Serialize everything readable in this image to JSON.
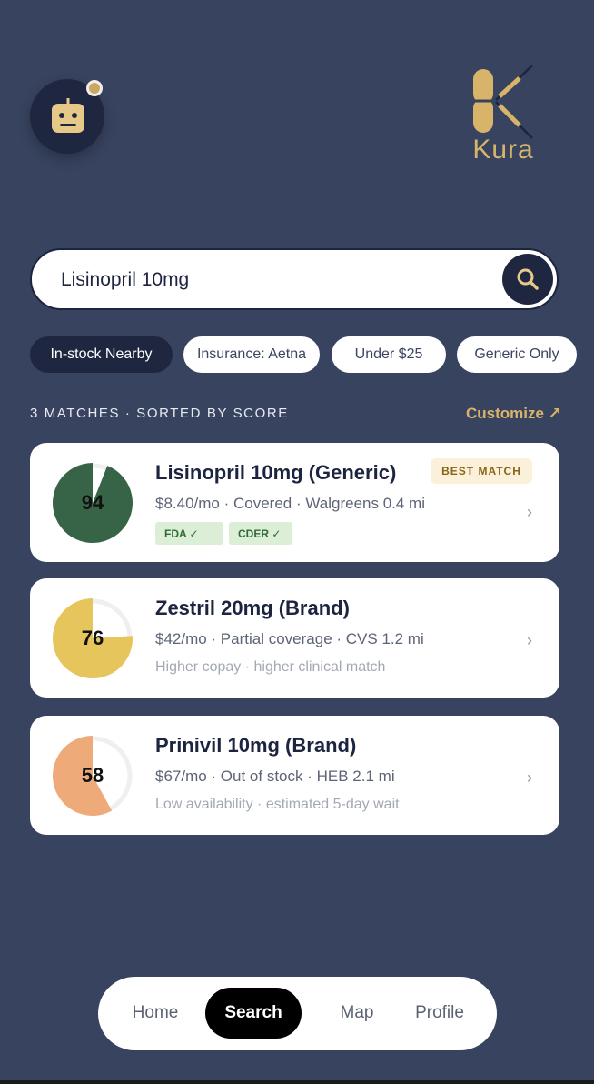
{
  "app": {
    "logo_text": "Kura"
  },
  "colors": {
    "background": "#38435f",
    "accent": "#d8b46a",
    "navy": "#1f2740"
  },
  "search": {
    "value": "Lisinopril 10mg",
    "icon": "search-icon"
  },
  "filters": [
    {
      "label": "In-stock Nearby",
      "active": true
    },
    {
      "label": "Insurance: Aetna",
      "active": false
    },
    {
      "label": "Under $25",
      "active": false
    },
    {
      "label": "Generic Only",
      "active": false
    }
  ],
  "results": {
    "summary": "3 MATCHES · SORTED BY SCORE",
    "customize_label": "Customize ↗",
    "items": [
      {
        "score": "94",
        "score_value": 94,
        "color": "#376447",
        "title": "Lisinopril 10mg (Generic)",
        "meta": "$8.40/mo  ·  Covered  ·  Walgreens 0.4 mi",
        "badge": "BEST MATCH",
        "tags": [
          "FDA ✓",
          "CDER ✓"
        ]
      },
      {
        "score": "76",
        "score_value": 76,
        "color": "#e5c55c",
        "title": "Zestril 20mg (Brand)",
        "meta": "$42/mo  ·  Partial coverage  ·  CVS 1.2 mi",
        "note": "Higher copay · higher clinical match"
      },
      {
        "score": "58",
        "score_value": 58,
        "color": "#efaa7a",
        "title": "Prinivil 10mg (Brand)",
        "meta": "$67/mo  ·  Out of stock  ·  HEB 2.1 mi",
        "note": "Low availability · estimated 5-day wait"
      }
    ]
  },
  "nav": [
    {
      "label": "Home",
      "active": false
    },
    {
      "label": "Search",
      "active": true
    },
    {
      "label": "Map",
      "active": false
    },
    {
      "label": "Profile",
      "active": false
    }
  ]
}
